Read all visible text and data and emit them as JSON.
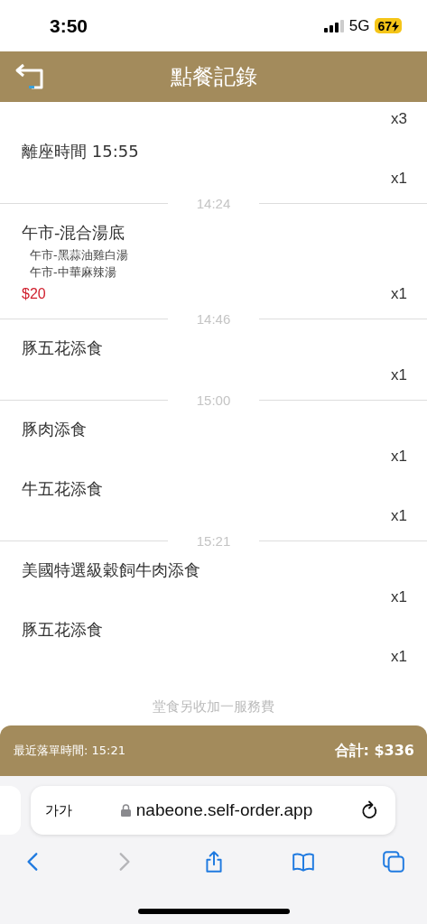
{
  "status_bar": {
    "time": "3:50",
    "network": "5G",
    "battery": "67"
  },
  "header": {
    "title": "點餐記錄"
  },
  "order_groups": [
    {
      "items": [
        {
          "qty": "x3"
        },
        {
          "name": "離座時間 15:55",
          "qty": "x1"
        }
      ]
    },
    {
      "time": "14:24",
      "items": [
        {
          "name": "午市-混合湯底",
          "options": [
            "午市-黑蒜油雞白湯",
            "午市-中華麻辣湯"
          ],
          "price": "$20",
          "qty": "x1"
        }
      ]
    },
    {
      "time": "14:46",
      "items": [
        {
          "name": "豚五花添食",
          "qty": "x1"
        }
      ]
    },
    {
      "time": "15:00",
      "items": [
        {
          "name": "豚肉添食",
          "qty": "x1"
        },
        {
          "name": "牛五花添食",
          "qty": "x1"
        }
      ]
    },
    {
      "time": "15:21",
      "items": [
        {
          "name": "美國特選級穀飼牛肉添食",
          "qty": "x1"
        },
        {
          "name": "豚五花添食",
          "qty": "x1"
        }
      ]
    }
  ],
  "note": "堂食另收加一服務費",
  "footer": {
    "last_order": "最近落單時間: 15:21",
    "total": "合計: $336"
  },
  "browser": {
    "text_size": "가가",
    "url": "nabeone.self-order.app",
    "toolbar": [
      {
        "kind": "back",
        "disabled": false
      },
      {
        "kind": "forward",
        "disabled": true
      },
      {
        "kind": "share",
        "disabled": false
      },
      {
        "kind": "bookmarks",
        "disabled": false
      },
      {
        "kind": "tabs",
        "disabled": false
      }
    ]
  }
}
